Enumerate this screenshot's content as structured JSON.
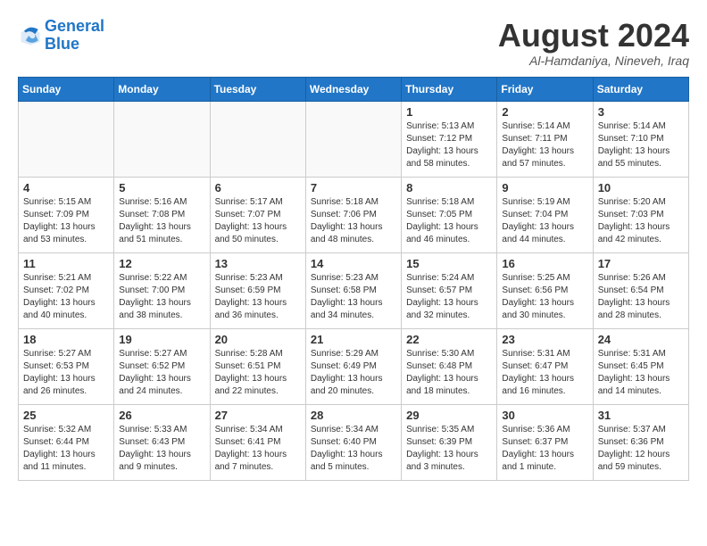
{
  "header": {
    "logo_line1": "General",
    "logo_line2": "Blue",
    "month_year": "August 2024",
    "location": "Al-Hamdaniya, Nineveh, Iraq"
  },
  "days_of_week": [
    "Sunday",
    "Monday",
    "Tuesday",
    "Wednesday",
    "Thursday",
    "Friday",
    "Saturday"
  ],
  "weeks": [
    [
      {
        "day": "",
        "info": ""
      },
      {
        "day": "",
        "info": ""
      },
      {
        "day": "",
        "info": ""
      },
      {
        "day": "",
        "info": ""
      },
      {
        "day": "1",
        "info": "Sunrise: 5:13 AM\nSunset: 7:12 PM\nDaylight: 13 hours\nand 58 minutes."
      },
      {
        "day": "2",
        "info": "Sunrise: 5:14 AM\nSunset: 7:11 PM\nDaylight: 13 hours\nand 57 minutes."
      },
      {
        "day": "3",
        "info": "Sunrise: 5:14 AM\nSunset: 7:10 PM\nDaylight: 13 hours\nand 55 minutes."
      }
    ],
    [
      {
        "day": "4",
        "info": "Sunrise: 5:15 AM\nSunset: 7:09 PM\nDaylight: 13 hours\nand 53 minutes."
      },
      {
        "day": "5",
        "info": "Sunrise: 5:16 AM\nSunset: 7:08 PM\nDaylight: 13 hours\nand 51 minutes."
      },
      {
        "day": "6",
        "info": "Sunrise: 5:17 AM\nSunset: 7:07 PM\nDaylight: 13 hours\nand 50 minutes."
      },
      {
        "day": "7",
        "info": "Sunrise: 5:18 AM\nSunset: 7:06 PM\nDaylight: 13 hours\nand 48 minutes."
      },
      {
        "day": "8",
        "info": "Sunrise: 5:18 AM\nSunset: 7:05 PM\nDaylight: 13 hours\nand 46 minutes."
      },
      {
        "day": "9",
        "info": "Sunrise: 5:19 AM\nSunset: 7:04 PM\nDaylight: 13 hours\nand 44 minutes."
      },
      {
        "day": "10",
        "info": "Sunrise: 5:20 AM\nSunset: 7:03 PM\nDaylight: 13 hours\nand 42 minutes."
      }
    ],
    [
      {
        "day": "11",
        "info": "Sunrise: 5:21 AM\nSunset: 7:02 PM\nDaylight: 13 hours\nand 40 minutes."
      },
      {
        "day": "12",
        "info": "Sunrise: 5:22 AM\nSunset: 7:00 PM\nDaylight: 13 hours\nand 38 minutes."
      },
      {
        "day": "13",
        "info": "Sunrise: 5:23 AM\nSunset: 6:59 PM\nDaylight: 13 hours\nand 36 minutes."
      },
      {
        "day": "14",
        "info": "Sunrise: 5:23 AM\nSunset: 6:58 PM\nDaylight: 13 hours\nand 34 minutes."
      },
      {
        "day": "15",
        "info": "Sunrise: 5:24 AM\nSunset: 6:57 PM\nDaylight: 13 hours\nand 32 minutes."
      },
      {
        "day": "16",
        "info": "Sunrise: 5:25 AM\nSunset: 6:56 PM\nDaylight: 13 hours\nand 30 minutes."
      },
      {
        "day": "17",
        "info": "Sunrise: 5:26 AM\nSunset: 6:54 PM\nDaylight: 13 hours\nand 28 minutes."
      }
    ],
    [
      {
        "day": "18",
        "info": "Sunrise: 5:27 AM\nSunset: 6:53 PM\nDaylight: 13 hours\nand 26 minutes."
      },
      {
        "day": "19",
        "info": "Sunrise: 5:27 AM\nSunset: 6:52 PM\nDaylight: 13 hours\nand 24 minutes."
      },
      {
        "day": "20",
        "info": "Sunrise: 5:28 AM\nSunset: 6:51 PM\nDaylight: 13 hours\nand 22 minutes."
      },
      {
        "day": "21",
        "info": "Sunrise: 5:29 AM\nSunset: 6:49 PM\nDaylight: 13 hours\nand 20 minutes."
      },
      {
        "day": "22",
        "info": "Sunrise: 5:30 AM\nSunset: 6:48 PM\nDaylight: 13 hours\nand 18 minutes."
      },
      {
        "day": "23",
        "info": "Sunrise: 5:31 AM\nSunset: 6:47 PM\nDaylight: 13 hours\nand 16 minutes."
      },
      {
        "day": "24",
        "info": "Sunrise: 5:31 AM\nSunset: 6:45 PM\nDaylight: 13 hours\nand 14 minutes."
      }
    ],
    [
      {
        "day": "25",
        "info": "Sunrise: 5:32 AM\nSunset: 6:44 PM\nDaylight: 13 hours\nand 11 minutes."
      },
      {
        "day": "26",
        "info": "Sunrise: 5:33 AM\nSunset: 6:43 PM\nDaylight: 13 hours\nand 9 minutes."
      },
      {
        "day": "27",
        "info": "Sunrise: 5:34 AM\nSunset: 6:41 PM\nDaylight: 13 hours\nand 7 minutes."
      },
      {
        "day": "28",
        "info": "Sunrise: 5:34 AM\nSunset: 6:40 PM\nDaylight: 13 hours\nand 5 minutes."
      },
      {
        "day": "29",
        "info": "Sunrise: 5:35 AM\nSunset: 6:39 PM\nDaylight: 13 hours\nand 3 minutes."
      },
      {
        "day": "30",
        "info": "Sunrise: 5:36 AM\nSunset: 6:37 PM\nDaylight: 13 hours\nand 1 minute."
      },
      {
        "day": "31",
        "info": "Sunrise: 5:37 AM\nSunset: 6:36 PM\nDaylight: 12 hours\nand 59 minutes."
      }
    ]
  ]
}
